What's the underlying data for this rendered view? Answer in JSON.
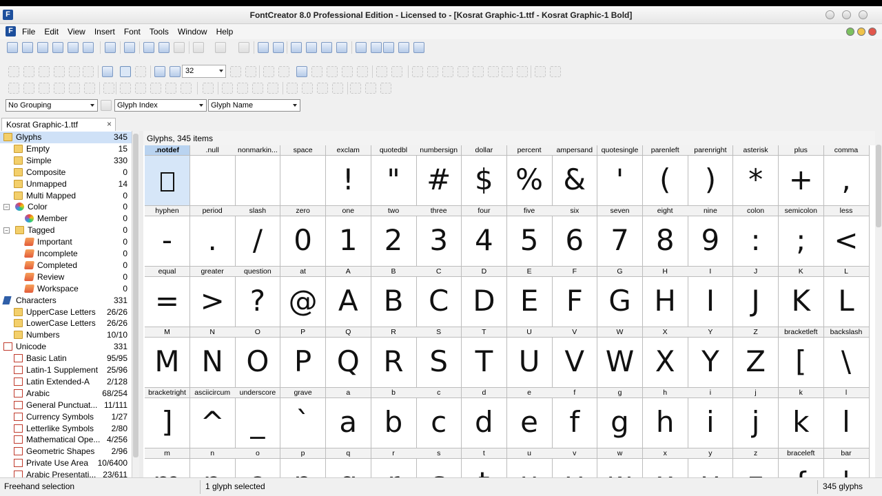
{
  "window": {
    "title": "FontCreator 8.0 Professional Edition - Licensed to  - [Kosrat Graphic-1.ttf - Kosrat Graphic-1 Bold]",
    "app_icon": "F"
  },
  "menu": [
    "File",
    "Edit",
    "View",
    "Insert",
    "Font",
    "Tools",
    "Window",
    "Help"
  ],
  "toolbar": {
    "zoom_value": "32",
    "grouping": "No Grouping",
    "sort_by": "Glyph Index",
    "display": "Glyph Name"
  },
  "document_tab": {
    "label": "Kosrat Graphic-1.ttf",
    "close": "×"
  },
  "tree": [
    {
      "label": "Glyphs",
      "count": "345",
      "icon": "folder-icon",
      "level": 0,
      "selected": true
    },
    {
      "label": "Empty",
      "count": "15",
      "icon": "folder-icon",
      "level": 1
    },
    {
      "label": "Simple",
      "count": "330",
      "icon": "folder-icon",
      "level": 1
    },
    {
      "label": "Composite",
      "count": "0",
      "icon": "folder-icon",
      "level": 1
    },
    {
      "label": "Unmapped",
      "count": "14",
      "icon": "folder-icon",
      "level": 1
    },
    {
      "label": "Multi Mapped",
      "count": "0",
      "icon": "folder-icon",
      "level": 1
    },
    {
      "label": "Color",
      "count": "0",
      "icon": "color-icon",
      "level": 0,
      "expander": "−"
    },
    {
      "label": "Member",
      "count": "0",
      "icon": "color-icon",
      "level": 2
    },
    {
      "label": "Tagged",
      "count": "0",
      "icon": "folder-icon",
      "level": 0,
      "expander": "−"
    },
    {
      "label": "Important",
      "count": "0",
      "icon": "tag-icon",
      "level": 2
    },
    {
      "label": "Incomplete",
      "count": "0",
      "icon": "tag-icon",
      "level": 2
    },
    {
      "label": "Completed",
      "count": "0",
      "icon": "tag-icon",
      "level": 2
    },
    {
      "label": "Review",
      "count": "0",
      "icon": "tag-icon",
      "level": 2
    },
    {
      "label": "Workspace",
      "count": "0",
      "icon": "tag-icon",
      "level": 2
    },
    {
      "label": "Characters",
      "count": "331",
      "icon": "characters-icon",
      "level": 0
    },
    {
      "label": "UpperCase Letters",
      "count": "26/26",
      "icon": "folder-icon",
      "level": 1
    },
    {
      "label": "LowerCase Letters",
      "count": "26/26",
      "icon": "folder-icon",
      "level": 1
    },
    {
      "label": "Numbers",
      "count": "10/10",
      "icon": "folder-icon",
      "level": 1
    },
    {
      "label": "Unicode",
      "count": "331",
      "icon": "unicode-icon",
      "level": 0
    },
    {
      "label": "Basic Latin",
      "count": "95/95",
      "icon": "unicode-icon",
      "level": 1
    },
    {
      "label": "Latin-1 Supplement",
      "count": "25/96",
      "icon": "unicode-icon",
      "level": 1
    },
    {
      "label": "Latin Extended-A",
      "count": "2/128",
      "icon": "unicode-icon",
      "level": 1
    },
    {
      "label": "Arabic",
      "count": "68/254",
      "icon": "unicode-icon",
      "level": 1
    },
    {
      "label": "General Punctuat...",
      "count": "11/111",
      "icon": "unicode-icon",
      "level": 1
    },
    {
      "label": "Currency Symbols",
      "count": "1/27",
      "icon": "unicode-icon",
      "level": 1
    },
    {
      "label": "Letterlike Symbols",
      "count": "2/80",
      "icon": "unicode-icon",
      "level": 1
    },
    {
      "label": "Mathematical Ope...",
      "count": "4/256",
      "icon": "unicode-icon",
      "level": 1
    },
    {
      "label": "Geometric Shapes",
      "count": "2/96",
      "icon": "unicode-icon",
      "level": 1
    },
    {
      "label": "Private Use Area",
      "count": "10/6400",
      "icon": "unicode-icon",
      "level": 1
    },
    {
      "label": "Arabic Presentati...",
      "count": "23/611",
      "icon": "unicode-icon",
      "level": 1
    }
  ],
  "grid": {
    "header": "Glyphs, 345 items",
    "glyphs": [
      [
        "notdef-box",
        ".notdef"
      ],
      [
        "",
        ".null"
      ],
      [
        "",
        "nonmarkin..."
      ],
      [
        "",
        "space"
      ],
      [
        "!",
        "exclam"
      ],
      [
        "\"",
        "quotedbl"
      ],
      [
        "#",
        "numbersign"
      ],
      [
        "$",
        "dollar"
      ],
      [
        "%",
        "percent"
      ],
      [
        "&",
        "ampersand"
      ],
      [
        "'",
        "quotesingle"
      ],
      [
        "(",
        "parenleft"
      ],
      [
        ")",
        "parenright"
      ],
      [
        "*",
        "asterisk"
      ],
      [
        "+",
        "plus"
      ],
      [
        ",",
        "comma"
      ],
      [
        "-",
        "hyphen"
      ],
      [
        ".",
        "period"
      ],
      [
        "/",
        "slash"
      ],
      [
        "0",
        "zero"
      ],
      [
        "1",
        "one"
      ],
      [
        "2",
        "two"
      ],
      [
        "3",
        "three"
      ],
      [
        "4",
        "four"
      ],
      [
        "5",
        "five"
      ],
      [
        "6",
        "six"
      ],
      [
        "7",
        "seven"
      ],
      [
        "8",
        "eight"
      ],
      [
        "9",
        "nine"
      ],
      [
        ":",
        "colon"
      ],
      [
        ";",
        "semicolon"
      ],
      [
        "<",
        "less"
      ],
      [
        "=",
        "equal"
      ],
      [
        ">",
        "greater"
      ],
      [
        "?",
        "question"
      ],
      [
        "@",
        "at"
      ],
      [
        "A",
        "A"
      ],
      [
        "B",
        "B"
      ],
      [
        "C",
        "C"
      ],
      [
        "D",
        "D"
      ],
      [
        "E",
        "E"
      ],
      [
        "F",
        "F"
      ],
      [
        "G",
        "G"
      ],
      [
        "H",
        "H"
      ],
      [
        "I",
        "I"
      ],
      [
        "J",
        "J"
      ],
      [
        "K",
        "K"
      ],
      [
        "L",
        "L"
      ],
      [
        "M",
        "M"
      ],
      [
        "N",
        "N"
      ],
      [
        "O",
        "O"
      ],
      [
        "P",
        "P"
      ],
      [
        "Q",
        "Q"
      ],
      [
        "R",
        "R"
      ],
      [
        "S",
        "S"
      ],
      [
        "T",
        "T"
      ],
      [
        "U",
        "U"
      ],
      [
        "V",
        "V"
      ],
      [
        "W",
        "W"
      ],
      [
        "X",
        "X"
      ],
      [
        "Y",
        "Y"
      ],
      [
        "Z",
        "Z"
      ],
      [
        "[",
        "bracketleft"
      ],
      [
        "\\",
        "backslash"
      ],
      [
        "]",
        "bracketright"
      ],
      [
        "^",
        "asciicircum"
      ],
      [
        "_",
        "underscore"
      ],
      [
        "`",
        "grave"
      ],
      [
        "a",
        "a"
      ],
      [
        "b",
        "b"
      ],
      [
        "c",
        "c"
      ],
      [
        "d",
        "d"
      ],
      [
        "e",
        "e"
      ],
      [
        "f",
        "f"
      ],
      [
        "g",
        "g"
      ],
      [
        "h",
        "h"
      ],
      [
        "i",
        "i"
      ],
      [
        "j",
        "j"
      ],
      [
        "k",
        "k"
      ],
      [
        "l",
        "l"
      ],
      [
        "m",
        "m"
      ],
      [
        "n",
        "n"
      ],
      [
        "o",
        "o"
      ],
      [
        "p",
        "p"
      ],
      [
        "q",
        "q"
      ],
      [
        "r",
        "r"
      ],
      [
        "s",
        "s"
      ],
      [
        "t",
        "t"
      ],
      [
        "u",
        "u"
      ],
      [
        "v",
        "v"
      ],
      [
        "w",
        "w"
      ],
      [
        "x",
        "x"
      ],
      [
        "y",
        "y"
      ],
      [
        "z",
        "z"
      ],
      [
        "{",
        "braceleft"
      ],
      [
        "|",
        "bar"
      ]
    ],
    "selected_index": 0
  },
  "status": {
    "mode": "Freehand selection",
    "selection": "1 glyph selected",
    "total": "345 glyphs"
  },
  "colors": {
    "selection": "#d6e6f8",
    "tree_selection": "#cfe1f7",
    "unicode_icon": "#c0392b",
    "folder_icon": "#f3cf6b"
  }
}
